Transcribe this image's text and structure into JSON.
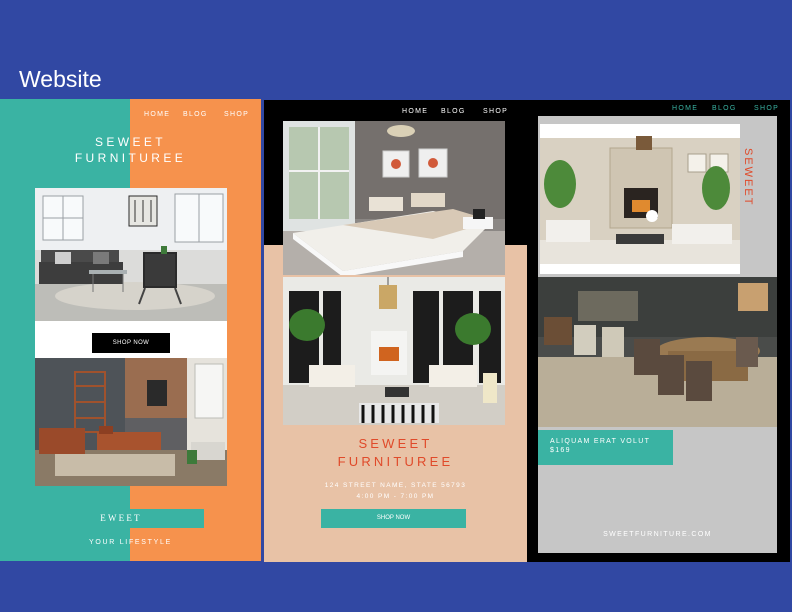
{
  "page_title": "Website",
  "panel1": {
    "nav": [
      "HOME",
      "BLOG",
      "SHOP"
    ],
    "brand_line1": "SEWEET",
    "brand_line2": "FURNITUREE",
    "shop_button": "SHOP NOW",
    "box_text": "EWEET",
    "tagline": "YOUR LIFESTYLE",
    "colors": {
      "teal": "#3ab3a3",
      "orange": "#f6924d"
    }
  },
  "panel2": {
    "nav": [
      "HOME",
      "BLOG",
      "SHOP"
    ],
    "brand_line1": "SEWEET",
    "brand_line2": "FURNITUREE",
    "address_line1": "124 STREET NAME, STATE 56793",
    "address_line2": "4:00 PM - 7:00 PM",
    "shop_button": "SHOP NOW",
    "colors": {
      "peach": "#e8c2a6",
      "brand_red": "#e04a2a"
    }
  },
  "panel3": {
    "nav": [
      "HOME",
      "BLOG",
      "SHOP"
    ],
    "vertical_brand": "SEWEET",
    "promo_line1": "ALIQUAM ERAT VOLUT",
    "promo_line2": "$169",
    "url": "SWEETFURNITURE.COM",
    "colors": {
      "gray": "#c6c6c6",
      "teal": "#3ab3a3"
    }
  }
}
